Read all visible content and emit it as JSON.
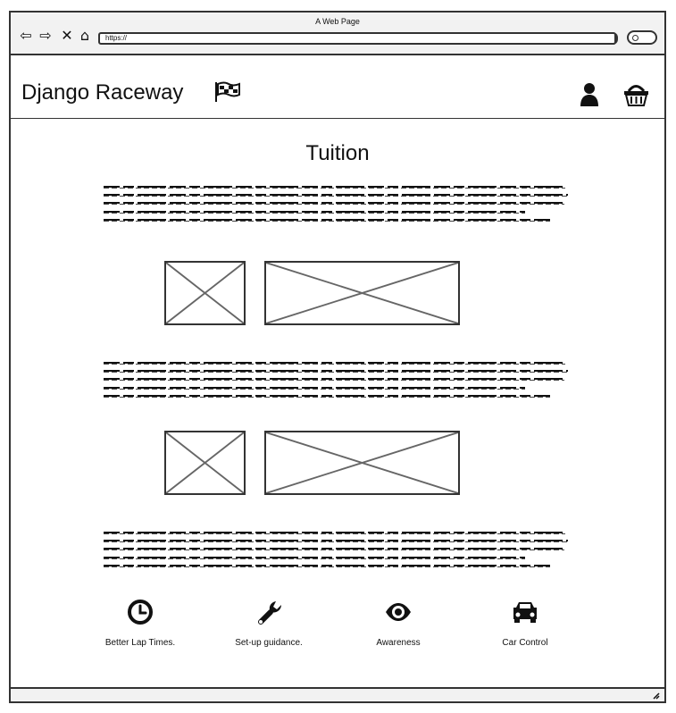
{
  "window": {
    "title": "A Web Page",
    "address": "https://"
  },
  "header": {
    "brand": "Django Raceway"
  },
  "main": {
    "title": "Tuition"
  },
  "features": [
    {
      "icon": "clock-icon",
      "label": "Better Lap Times."
    },
    {
      "icon": "wrench-icon",
      "label": "Set-up guidance."
    },
    {
      "icon": "eye-icon",
      "label": "Awareness"
    },
    {
      "icon": "car-icon",
      "label": "Car Control"
    }
  ]
}
